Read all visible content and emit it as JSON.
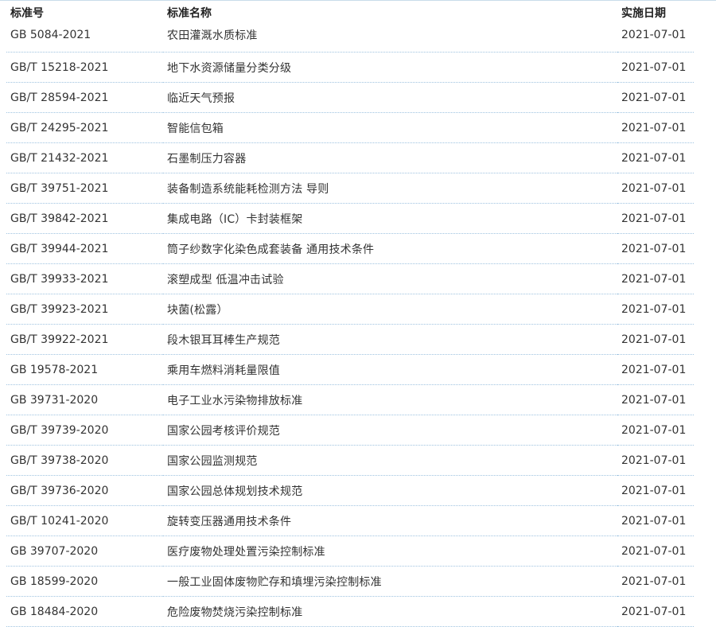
{
  "table": {
    "headers": {
      "number": "标准号",
      "name": "标准名称",
      "date": "实施日期"
    },
    "rows": [
      {
        "number": "GB 5084-2021",
        "name": "农田灌溉水质标准",
        "date": "2021-07-01"
      },
      {
        "number": "GB/T 15218-2021",
        "name": "地下水资源储量分类分级",
        "date": "2021-07-01"
      },
      {
        "number": "GB/T 28594-2021",
        "name": "临近天气预报",
        "date": "2021-07-01"
      },
      {
        "number": "GB/T 24295-2021",
        "name": "智能信包箱",
        "date": "2021-07-01"
      },
      {
        "number": "GB/T 21432-2021",
        "name": "石墨制压力容器",
        "date": "2021-07-01"
      },
      {
        "number": "GB/T 39751-2021",
        "name": "装备制造系统能耗检测方法 导则",
        "date": "2021-07-01"
      },
      {
        "number": "GB/T 39842-2021",
        "name": "集成电路（IC）卡封装框架",
        "date": "2021-07-01"
      },
      {
        "number": "GB/T 39944-2021",
        "name": "筒子纱数字化染色成套装备 通用技术条件",
        "date": "2021-07-01"
      },
      {
        "number": "GB/T 39933-2021",
        "name": "滚塑成型 低温冲击试验",
        "date": "2021-07-01"
      },
      {
        "number": "GB/T 39923-2021",
        "name": "块菌(松露）",
        "date": "2021-07-01"
      },
      {
        "number": "GB/T 39922-2021",
        "name": "段木银耳耳棒生产规范",
        "date": "2021-07-01"
      },
      {
        "number": "GB 19578-2021",
        "name": "乘用车燃料消耗量限值",
        "date": "2021-07-01"
      },
      {
        "number": "GB 39731-2020",
        "name": "电子工业水污染物排放标准",
        "date": "2021-07-01"
      },
      {
        "number": "GB/T 39739-2020",
        "name": "国家公园考核评价规范",
        "date": "2021-07-01"
      },
      {
        "number": "GB/T 39738-2020",
        "name": "国家公园监测规范",
        "date": "2021-07-01"
      },
      {
        "number": "GB/T 39736-2020",
        "name": "国家公园总体规划技术规范",
        "date": "2021-07-01"
      },
      {
        "number": "GB/T 10241-2020",
        "name": "旋转变压器通用技术条件",
        "date": "2021-07-01"
      },
      {
        "number": "GB 39707-2020",
        "name": "医疗废物处理处置污染控制标准",
        "date": "2021-07-01"
      },
      {
        "number": "GB 18599-2020",
        "name": "一般工业固体废物贮存和填埋污染控制标准",
        "date": "2021-07-01"
      },
      {
        "number": "GB 18484-2020",
        "name": "危险废物焚烧污染控制标准",
        "date": "2021-07-01"
      }
    ]
  }
}
